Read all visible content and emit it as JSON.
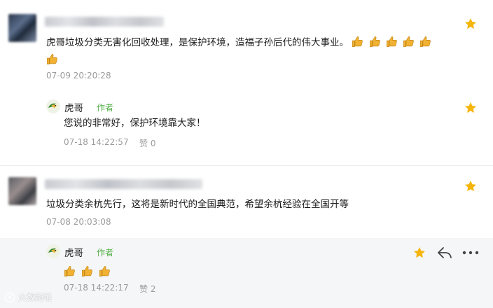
{
  "comments": [
    {
      "text": "虎哥垃圾分类无害化回收处理，是保护环境，造福子孙后代的伟大事业。",
      "reaction_icons": [
        "thumbs-up-icon",
        "thumbs-up-icon",
        "thumbs-up-icon",
        "thumbs-up-icon",
        "thumbs-up-icon",
        "thumbs-up-icon"
      ],
      "time": "07-09 20:20:28",
      "reply": {
        "author": "虎哥",
        "badge": "作者",
        "text": "您说的非常好，保护环境靠大家！",
        "time": "07-18 14:22:57",
        "likes": "赞 0"
      }
    },
    {
      "text": "垃圾分类余杭先行，这将是新时代的全国典范，希望余杭经验在全国开等",
      "time": "07-08 20:03:08",
      "reply": {
        "author": "虎哥",
        "badge": "作者",
        "reaction_icons": [
          "thumbs-up-icon",
          "thumbs-up-icon",
          "thumbs-up-icon"
        ],
        "time": "07-18 14:22:17",
        "likes": "赞 2"
      }
    }
  ],
  "watermark": "大数跨境",
  "colors": {
    "star": "#f5b50a",
    "badge": "#55b04a",
    "meta": "#9b9b9b"
  }
}
